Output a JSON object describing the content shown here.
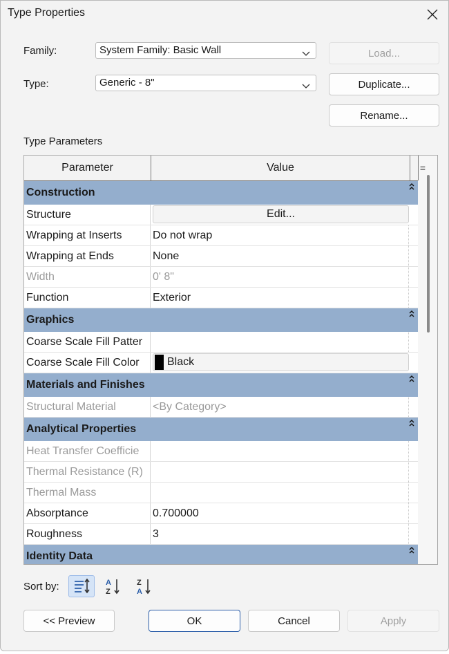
{
  "window": {
    "title": "Type Properties"
  },
  "family": {
    "label": "Family:",
    "value": "System Family: Basic Wall"
  },
  "type": {
    "label": "Type:",
    "value": "Generic - 8\""
  },
  "buttons": {
    "load": "Load...",
    "duplicate": "Duplicate...",
    "rename": "Rename...",
    "preview": "<< Preview",
    "ok": "OK",
    "cancel": "Cancel",
    "apply": "Apply"
  },
  "type_parameters": {
    "heading": "Type Parameters",
    "columns": {
      "parameter": "Parameter",
      "value": "Value",
      "eq": "="
    },
    "groups": [
      {
        "name": "Construction",
        "rows": [
          {
            "param": "Structure",
            "value": "Edit...",
            "kind": "button"
          },
          {
            "param": "Wrapping at Inserts",
            "value": "Do not wrap"
          },
          {
            "param": "Wrapping at Ends",
            "value": "None"
          },
          {
            "param": "Width",
            "value": "0'  8\"",
            "dim": true
          },
          {
            "param": "Function",
            "value": "Exterior"
          }
        ]
      },
      {
        "name": "Graphics",
        "rows": [
          {
            "param": "Coarse Scale Fill Patter",
            "value": ""
          },
          {
            "param": "Coarse Scale Fill Color",
            "value": "Black",
            "kind": "color",
            "swatch": "#000000"
          }
        ]
      },
      {
        "name": "Materials and Finishes",
        "rows": [
          {
            "param": "Structural Material",
            "value": "<By Category>",
            "dim": true
          }
        ]
      },
      {
        "name": "Analytical Properties",
        "rows": [
          {
            "param": "Heat Transfer Coefficie",
            "value": "",
            "dim": true
          },
          {
            "param": "Thermal Resistance (R)",
            "value": "",
            "dim": true
          },
          {
            "param": "Thermal Mass",
            "value": "",
            "dim": true
          },
          {
            "param": "Absorptance",
            "value": "0.700000"
          },
          {
            "param": "Roughness",
            "value": "3"
          }
        ]
      },
      {
        "name": "Identity Data",
        "rows": []
      }
    ]
  },
  "sort": {
    "label": "Sort by:",
    "options": [
      {
        "icon": "sort-grouped-icon",
        "active": true
      },
      {
        "icon": "sort-ascending-icon",
        "active": false
      },
      {
        "icon": "sort-descending-icon",
        "active": false
      }
    ]
  },
  "colors": {
    "group_header": "#94aecd",
    "accent": "#2a5da8",
    "active_sort": "#d5e4f7"
  }
}
